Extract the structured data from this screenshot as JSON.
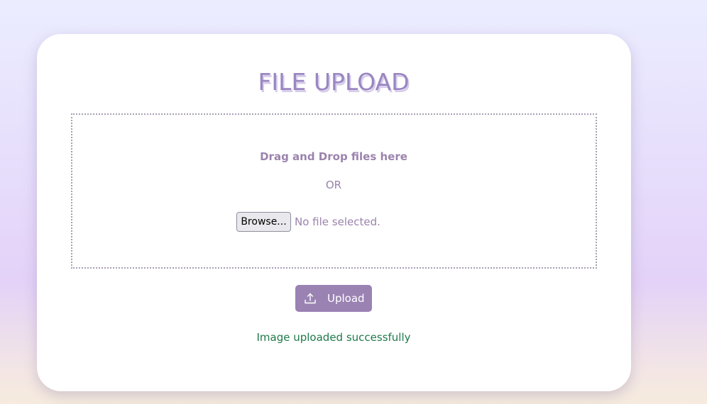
{
  "upload_card": {
    "title": "FILE UPLOAD",
    "dropzone": {
      "drag_text": "Drag and Drop files here",
      "or_text": "OR",
      "browse_label": "Browse...",
      "file_status": "No file selected."
    },
    "upload_button": {
      "label": "Upload",
      "icon": "upload-icon"
    },
    "status_message": "Image uploaded successfully"
  },
  "colors": {
    "accent": "#9a82b3",
    "title": "#9a86c2",
    "text_muted": "#9b83ad",
    "success": "#1e7a4a"
  }
}
